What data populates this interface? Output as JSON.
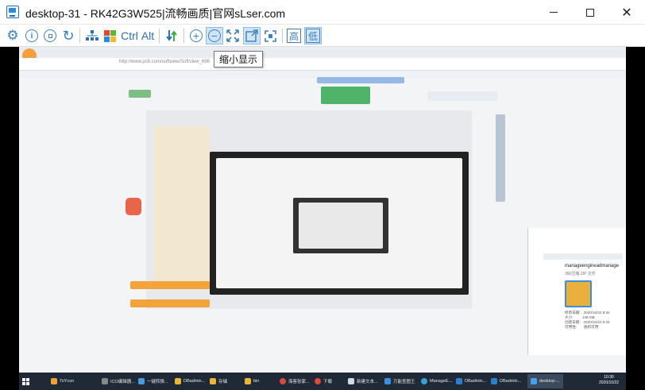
{
  "window": {
    "title": "desktop-31 - RK42G3W525|流畅画质|官网sLser.com"
  },
  "toolbar": {
    "buttons": [
      {
        "name": "settings",
        "label": "⚙"
      },
      {
        "name": "info",
        "label": "i"
      },
      {
        "name": "stop",
        "label": "▫"
      },
      {
        "name": "refresh",
        "label": "↻"
      },
      {
        "name": "network",
        "label": ""
      },
      {
        "name": "windows-key",
        "label": ""
      },
      {
        "name": "ctrl-key",
        "label": "Ctrl"
      },
      {
        "name": "alt-key",
        "label": "Alt"
      },
      {
        "name": "transfer",
        "label": "⇅"
      },
      {
        "name": "zoom-in",
        "label": "+"
      },
      {
        "name": "zoom-out",
        "label": "−"
      },
      {
        "name": "fit-screen",
        "label": ""
      },
      {
        "name": "shrink-display",
        "label": ""
      },
      {
        "name": "fullscreen",
        "label": ""
      },
      {
        "name": "quality-high",
        "label": "高"
      },
      {
        "name": "quality-low",
        "label": "低"
      }
    ]
  },
  "tooltip": {
    "text": "缩小显示"
  },
  "remote": {
    "url": "http://www.pc6.com/softview/SoftView_696",
    "panel": {
      "filename": "manageengineadmanage",
      "type": "360压缩 ZIP 文件",
      "meta": "修改日期:   2020/10/22 8:34\n大小:         148 MB\n创建日期:   2020/10/22 8:34\n可用性:       脱机可用"
    },
    "taskbar": [
      "ToYcon",
      "ICO编辑器...",
      "一键转换...",
      "DBadmin...",
      "存储",
      "bin",
      "海客张家...",
      "下载",
      "新建文本...",
      "万能查图王",
      "ManageE...",
      "DBadmin...",
      "DBadmin...",
      "desktop-..."
    ],
    "clock": {
      "time": "10:30",
      "date": "2020/10/22"
    }
  }
}
